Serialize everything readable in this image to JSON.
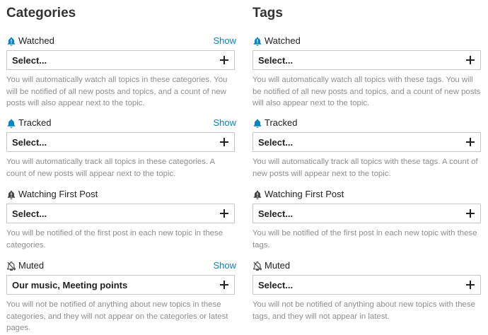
{
  "categories": {
    "title": "Categories",
    "show_label": "Show",
    "groups": [
      {
        "label": "Watched",
        "icon": "bell-exclamation-icon",
        "value": "Select...",
        "description": "You will automatically watch all topics in these categories. You will be notified of all new posts and topics, and a count of new posts will also appear next to the topic."
      },
      {
        "label": "Tracked",
        "icon": "bell-icon",
        "value": "Select...",
        "description": "You will automatically track all topics in these categories. A count of new posts will appear next to the topic."
      },
      {
        "label": "Watching First Post",
        "icon": "bell-exclamation-icon",
        "value": "Select...",
        "description": "You will be notified of the first post in each new topic in these categories."
      },
      {
        "label": "Muted",
        "icon": "bell-slash-icon",
        "value": "Our music, Meeting points",
        "description": "You will not be notified of anything about new topics in these categories, and they will not appear on the categories or latest pages."
      }
    ]
  },
  "tags": {
    "title": "Tags",
    "groups": [
      {
        "label": "Watched",
        "icon": "bell-exclamation-icon",
        "value": "Select...",
        "description": "You will automatically watch all topics with these tags. You will be notified of all new posts and topics, and a count of new posts will also appear next to the topic."
      },
      {
        "label": "Tracked",
        "icon": "bell-icon",
        "value": "Select...",
        "description": "You will automatically track all topics with these tags. A count of new posts will appear next to the topic."
      },
      {
        "label": "Watching First Post",
        "icon": "bell-exclamation-icon",
        "value": "Select...",
        "description": "You will be notified of the first post in each new topic with these tags."
      },
      {
        "label": "Muted",
        "icon": "bell-slash-icon",
        "value": "Select...",
        "description": "You will not be notified of anything about new topics with these tags, and they will not appear in latest."
      }
    ]
  },
  "colors": {
    "accent": "#0a83c1",
    "text": "#222222",
    "muted_text": "#8e8e8e",
    "border": "#c7c7c7"
  }
}
